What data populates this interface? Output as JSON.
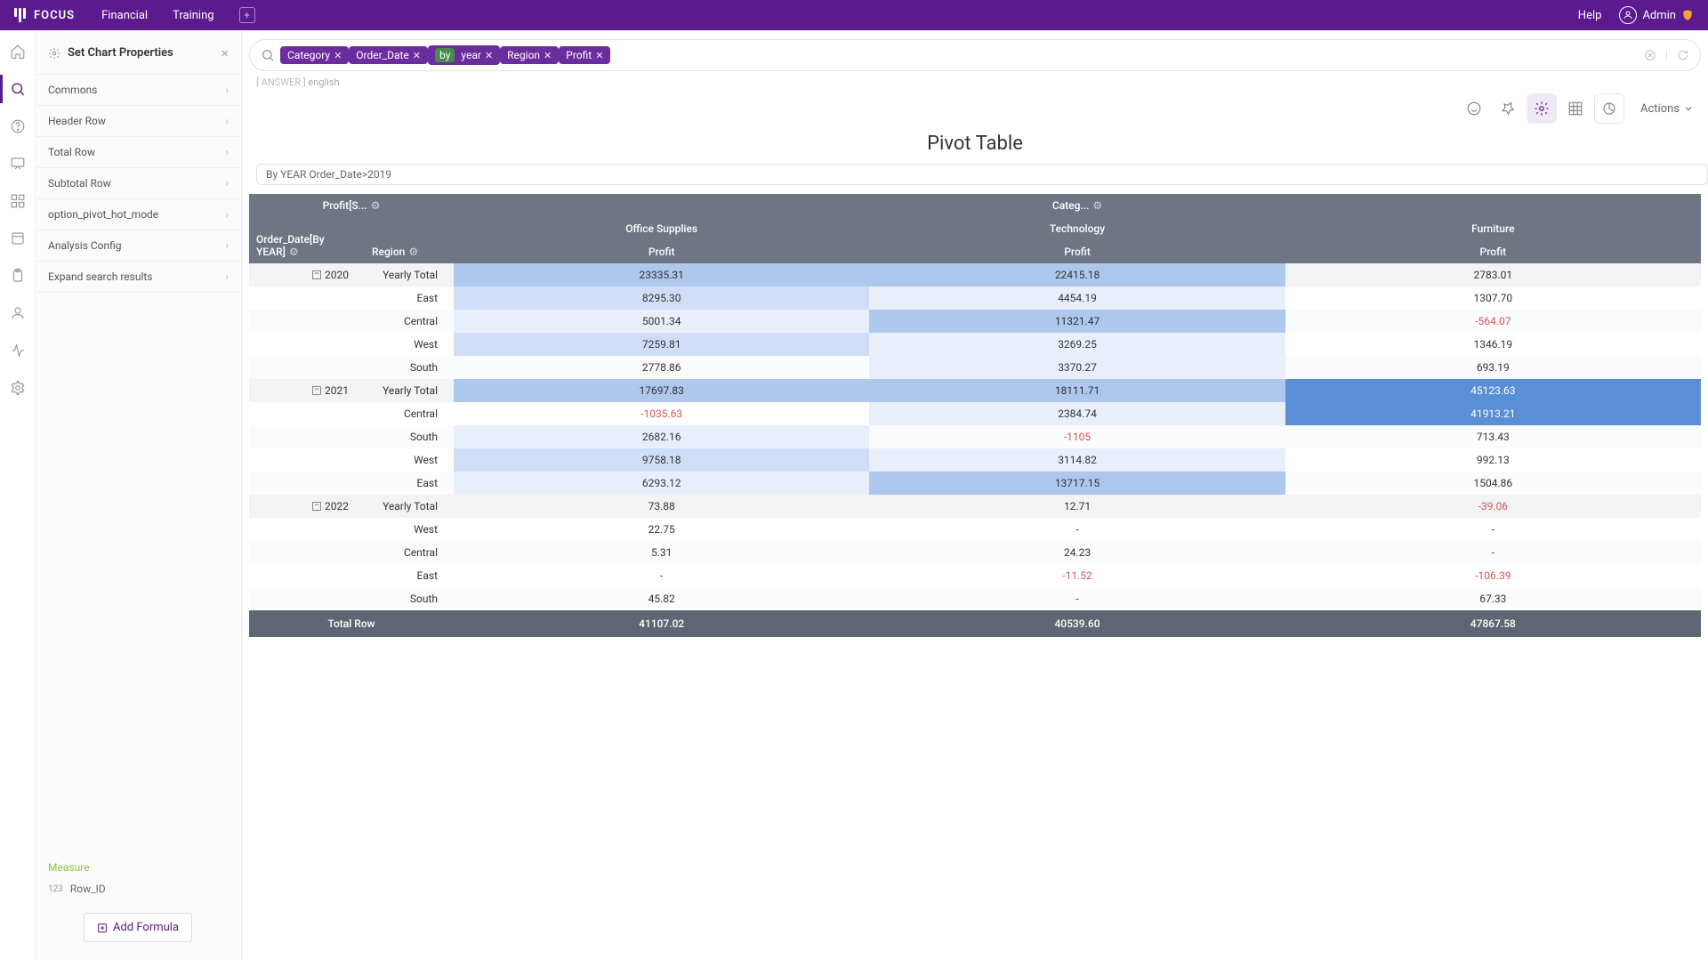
{
  "topbar": {
    "brand": "FOCUS",
    "nav": [
      "Financial",
      "Training"
    ],
    "help": "Help",
    "user": "Admin"
  },
  "sidePanel": {
    "title": "Set Chart Properties",
    "items": [
      "Commons",
      "Header Row",
      "Total Row",
      "Subtotal Row",
      "option_pivot_hot_mode",
      "Analysis Config",
      "Expand search results"
    ],
    "measureLabel": "Measure",
    "measureItem": "Row_ID",
    "measurePrefix": "123",
    "addFormula": "Add Formula"
  },
  "search": {
    "pills": [
      {
        "label": "Category",
        "kind": "dim"
      },
      {
        "label": "Order_Date",
        "kind": "dim"
      },
      {
        "label": "by",
        "kind": "by"
      },
      {
        "label": "year",
        "kind": "by2"
      },
      {
        "label": "Region",
        "kind": "dim"
      },
      {
        "label": "Profit",
        "kind": "dim"
      }
    ]
  },
  "crumb": {
    "answer": "[ ANSWER ]",
    "lang": "english"
  },
  "actionsLabel": "Actions",
  "title": "Pivot Table",
  "filterChip": "By YEAR Order_Date>2019",
  "pivot": {
    "measureHeader": "Profit[S...",
    "categoryHeader": "Categ...",
    "rowDim1": "Order_Date[By YEAR]",
    "rowDim2": "Region",
    "categories": [
      "Office Supplies",
      "Technology",
      "Furniture"
    ],
    "valueLabel": "Profit",
    "years": [
      {
        "year": "2020",
        "total": {
          "region": "Yearly Total",
          "vals": [
            "23335.31",
            "22415.18",
            "2783.01"
          ],
          "heat": [
            "heat3",
            "heat3",
            ""
          ]
        },
        "rows": [
          {
            "region": "East",
            "vals": [
              "8295.30",
              "4454.19",
              "1307.70"
            ],
            "heat": [
              "heat2",
              "heat1",
              ""
            ]
          },
          {
            "region": "Central",
            "vals": [
              "5001.34",
              "11321.47",
              "-564.07"
            ],
            "heat": [
              "heat1",
              "heat3",
              ""
            ],
            "neg": [
              false,
              false,
              true
            ]
          },
          {
            "region": "West",
            "vals": [
              "7259.81",
              "3269.25",
              "1346.19"
            ],
            "heat": [
              "heat2",
              "heat1",
              ""
            ]
          },
          {
            "region": "South",
            "vals": [
              "2778.86",
              "3370.27",
              "693.19"
            ],
            "heat": [
              "",
              "heat1",
              ""
            ]
          }
        ]
      },
      {
        "year": "2021",
        "total": {
          "region": "Yearly Total",
          "vals": [
            "17697.83",
            "18111.71",
            "45123.63"
          ],
          "heat": [
            "heat3",
            "heat3",
            "heat5"
          ]
        },
        "rows": [
          {
            "region": "Central",
            "vals": [
              "-1035.63",
              "2384.74",
              "41913.21"
            ],
            "heat": [
              "",
              "heat1",
              "heat5"
            ],
            "neg": [
              true,
              false,
              false
            ]
          },
          {
            "region": "South",
            "vals": [
              "2682.16",
              "-1105",
              "713.43"
            ],
            "heat": [
              "heat1",
              "",
              ""
            ],
            "neg": [
              false,
              true,
              false
            ]
          },
          {
            "region": "West",
            "vals": [
              "9758.18",
              "3114.82",
              "992.13"
            ],
            "heat": [
              "heat2",
              "heat1",
              ""
            ]
          },
          {
            "region": "East",
            "vals": [
              "6293.12",
              "13717.15",
              "1504.86"
            ],
            "heat": [
              "heat1",
              "heat3",
              ""
            ]
          }
        ]
      },
      {
        "year": "2022",
        "total": {
          "region": "Yearly Total",
          "vals": [
            "73.88",
            "12.71",
            "-39.06"
          ],
          "heat": [
            "",
            "",
            ""
          ],
          "neg": [
            false,
            false,
            true
          ]
        },
        "rows": [
          {
            "region": "West",
            "vals": [
              "22.75",
              "-",
              "-"
            ]
          },
          {
            "region": "Central",
            "vals": [
              "5.31",
              "24.23",
              "-"
            ]
          },
          {
            "region": "East",
            "vals": [
              "-",
              "-11.52",
              "-106.39"
            ],
            "neg": [
              false,
              true,
              true
            ]
          },
          {
            "region": "South",
            "vals": [
              "45.82",
              "-",
              "67.33"
            ]
          }
        ]
      }
    ],
    "totalRow": {
      "label": "Total Row",
      "vals": [
        "41107.02",
        "40539.60",
        "47867.58"
      ]
    }
  }
}
